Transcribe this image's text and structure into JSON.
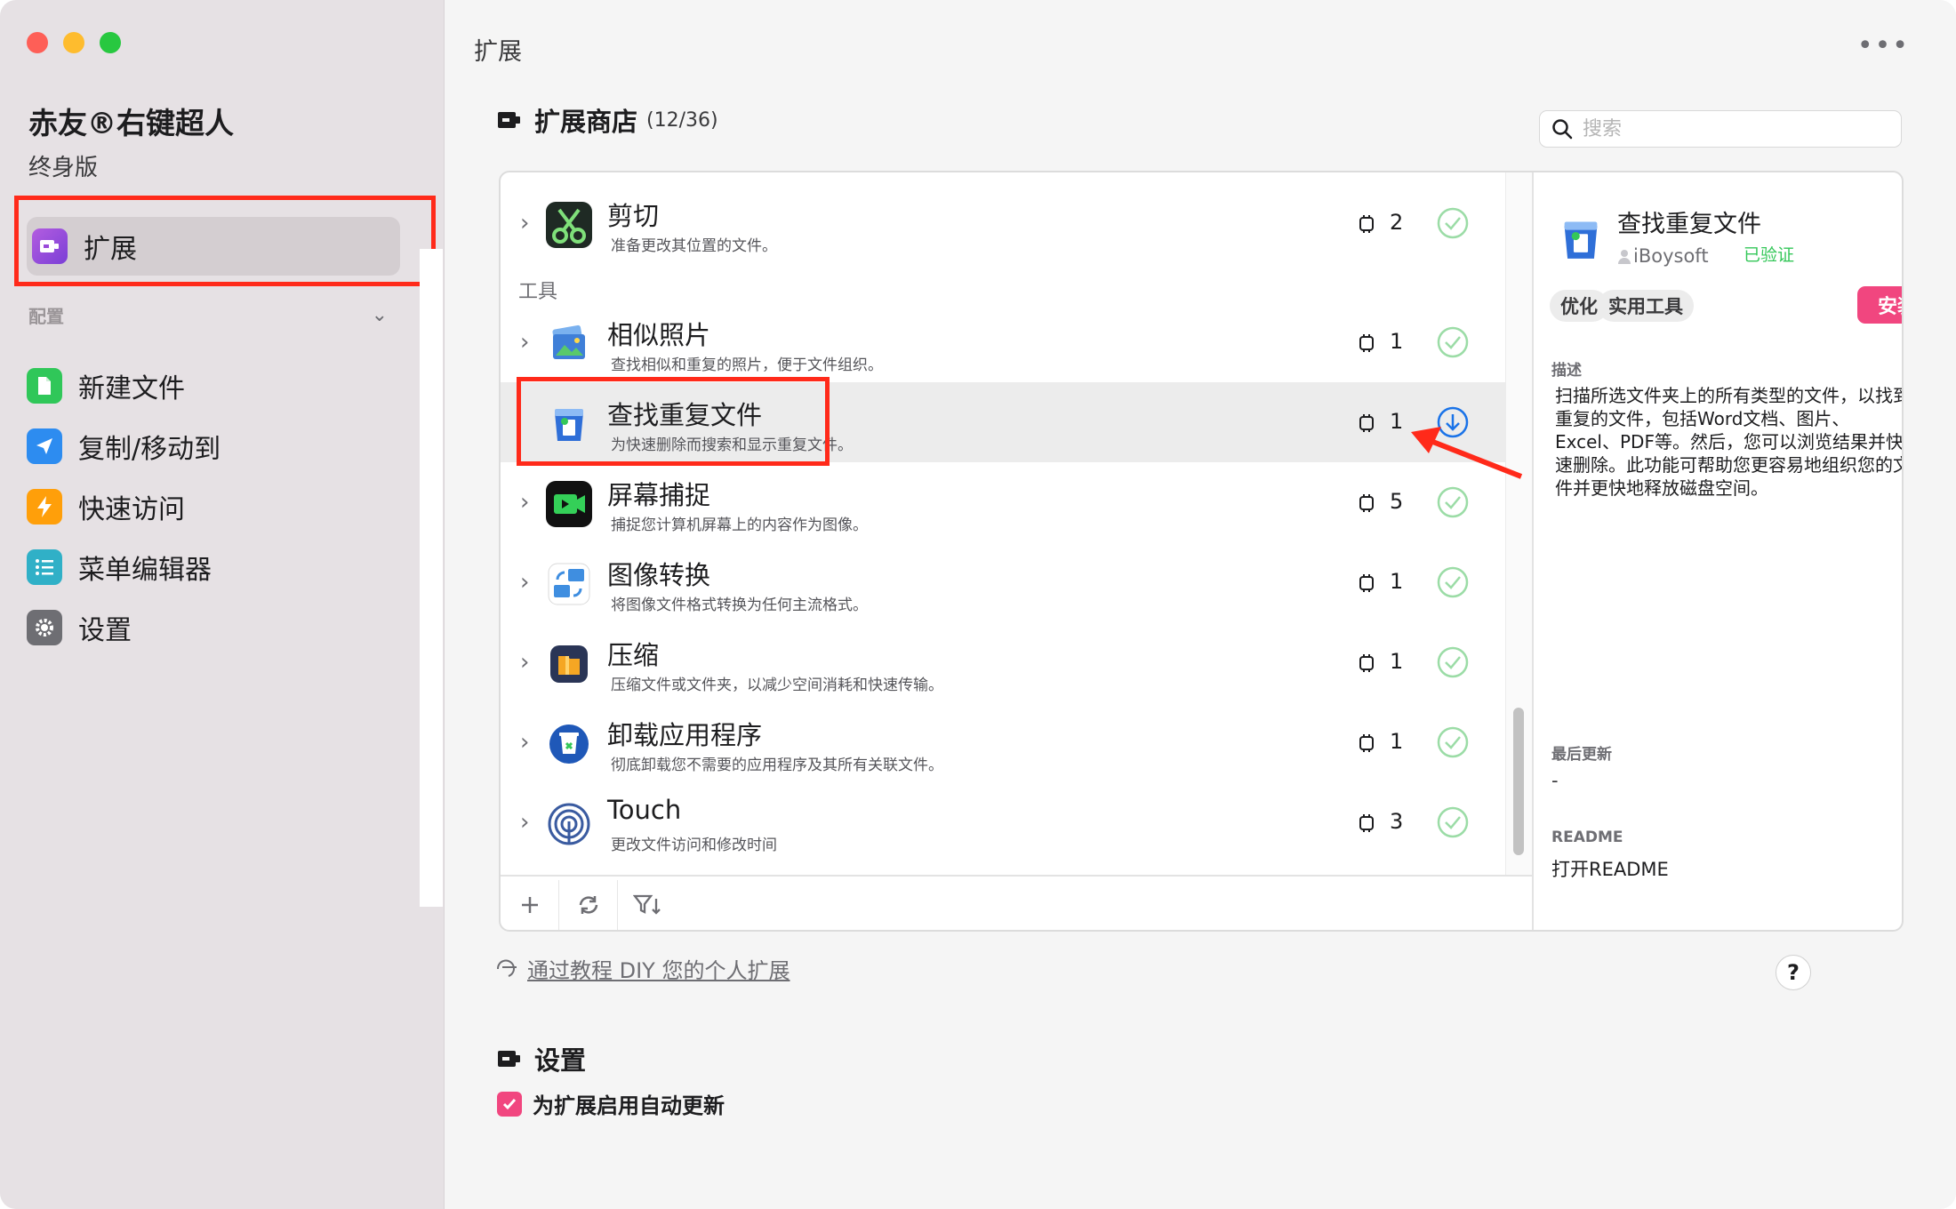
{
  "sidebar": {
    "app_name": "赤友®右键超人",
    "edition": "终身版",
    "active_item": "扩展",
    "config_header": "配置",
    "items": [
      {
        "label": "新建文件",
        "icon": "new-file-icon",
        "color": "#30c759"
      },
      {
        "label": "复制/移动到",
        "icon": "send-icon",
        "color": "#2d8cf0"
      },
      {
        "label": "快速访问",
        "icon": "lightning-icon",
        "color": "#ff9f0a"
      },
      {
        "label": "菜单编辑器",
        "icon": "list-icon",
        "color": "#30b0c7"
      },
      {
        "label": "设置",
        "icon": "gear-icon",
        "color": "#6e6e73"
      }
    ]
  },
  "main": {
    "title": "扩展",
    "store_title": "扩展商店",
    "store_count": "(12/36)",
    "search_placeholder": "搜索",
    "group_label": "工具",
    "extensions": [
      {
        "name": "剪切",
        "desc": "准备更改其位置的文件。",
        "count": "2",
        "status": "installed",
        "icon": "scissors-icon",
        "color": "#1f2a24"
      },
      {
        "name": "相似照片",
        "desc": "查找相似和重复的照片，便于文件组织。",
        "count": "1",
        "status": "installed",
        "icon": "photos-icon",
        "color": "#3f7fd8"
      },
      {
        "name": "查找重复文件",
        "desc": "为快速删除而搜索和显示重复文件。",
        "count": "1",
        "status": "download",
        "icon": "duplicate-files-icon",
        "color": "#2f6fd8"
      },
      {
        "name": "屏幕捕捉",
        "desc": "捕捉您计算机屏幕上的内容作为图像。",
        "count": "5",
        "status": "installed",
        "icon": "screen-capture-icon",
        "color": "#111111"
      },
      {
        "name": "图像转换",
        "desc": "将图像文件格式转换为任何主流格式。",
        "count": "1",
        "status": "installed",
        "icon": "image-convert-icon",
        "color": "#3f8ee0"
      },
      {
        "name": "压缩",
        "desc": "压缩文件或文件夹，以减少空间消耗和快速传输。",
        "count": "1",
        "status": "installed",
        "icon": "compress-icon",
        "color": "#2a3556"
      },
      {
        "name": "卸载应用程序",
        "desc": "彻底卸载您不需要的应用程序及其所有关联文件。",
        "count": "1",
        "status": "installed",
        "icon": "uninstall-icon",
        "color": "#1f58b8"
      },
      {
        "name": "Touch",
        "desc": "更改文件访问和修改时间",
        "count": "3",
        "status": "installed",
        "icon": "fingerprint-icon",
        "color": "#3a5ba0"
      }
    ]
  },
  "detail": {
    "name": "查找重复文件",
    "author": "iBoysoft",
    "verified": "已验证",
    "tags": [
      "优化",
      "实用工具"
    ],
    "install_label": "安装",
    "desc_label": "描述",
    "description": "扫描所选文件夹上的所有类型的文件，以找到重复的文件，包括Word文档、图片、Excel、PDF等。然后，您可以浏览结果并快速删除。此功能可帮助您更容易地组织您的文件并更快地释放磁盘空间。",
    "updated_label": "最后更新",
    "updated_value": "-",
    "readme_label": "README",
    "readme_link": "打开README"
  },
  "tutorial_link": "通过教程 DIY 您的个人扩展",
  "help": "?",
  "settings": {
    "title": "设置",
    "auto_update_label": "为扩展启用自动更新",
    "auto_update_checked": true
  },
  "colors": {
    "accent_pink": "#f1467f",
    "verified_green": "#34c759",
    "installed_green": "#9bdca6",
    "download_blue": "#1a73e8",
    "annotation_red": "#ff2a1a"
  }
}
